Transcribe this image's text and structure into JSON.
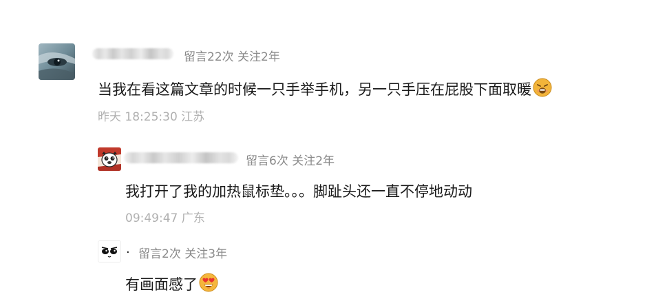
{
  "comments": [
    {
      "meta": "留言22次 关注2年",
      "text": "当我在看这篇文章的时候一只手举手机，另一只手压在屁股下面取暖",
      "time_location": "昨天 18:25:30 江苏",
      "emoji_icon": "grimace-emoji-icon"
    },
    {
      "meta": "留言6次 关注2年",
      "text": "我打开了我的加热鼠标垫。。。脚趾头还一直不停地动动",
      "time_location": "09:49:47 广东"
    },
    {
      "name": ".",
      "meta": "留言2次 关注3年",
      "text": "有画面感了",
      "emoji_icon": "heart-eyes-emoji-icon"
    }
  ],
  "colors": {
    "text": "#1a1a1a",
    "meta": "#8a8a8a",
    "time": "#b0b0b0",
    "background": "#ffffff"
  }
}
